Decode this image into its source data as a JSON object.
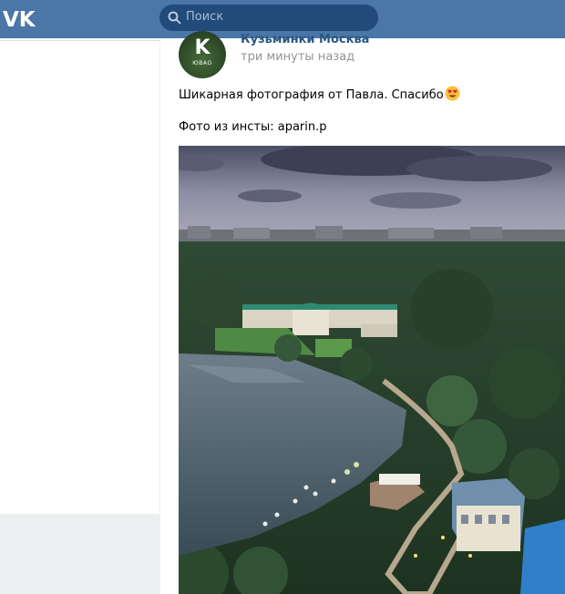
{
  "header": {
    "logo": "vk-logo",
    "search_placeholder": "Поиск",
    "search_icon": "search-icon",
    "brand_color": "#4a76a8"
  },
  "post": {
    "author": "Кузьминки Москва",
    "time": "три минуты назад",
    "avatar_letter": "K",
    "avatar_caption": "ЮВАО",
    "text_line1": "Шикарная фотография от Павла. Спасибо",
    "emoji": "heart-eyes-emoji",
    "text_line2": "Фото из инсты: aparin.p",
    "photo": "aerial-photo-kuzminki-park"
  }
}
